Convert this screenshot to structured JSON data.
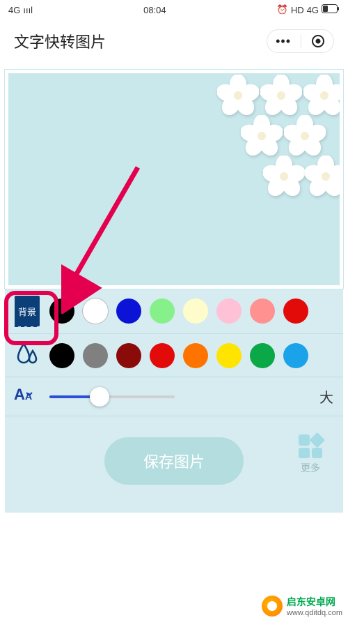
{
  "status": {
    "network": "4G",
    "signal": "ıııl",
    "time": "08:04",
    "alarm": "⏰",
    "hd": "HD",
    "net2": "4G",
    "battery": "▭"
  },
  "nav": {
    "title": "文字快转图片",
    "more_dots": "•••"
  },
  "tools": {
    "bg_label": "背景",
    "bg_colors": [
      "#000000",
      "#ffffff",
      "#0b14d6",
      "#86f08a",
      "#fffccb",
      "#ffc1d5",
      "#ff9191",
      "#e30a0a"
    ],
    "fill_colors": [
      "#000000",
      "#808080",
      "#8b0a0a",
      "#e30a0a",
      "#ff7400",
      "#ffe400",
      "#0aa846",
      "#1aa3e8"
    ],
    "size_label": "大",
    "slider_percent": 40
  },
  "actions": {
    "save": "保存图片",
    "more": "更多"
  },
  "watermark": {
    "cn": "启东安卓网",
    "url": "www.qditdq.com"
  }
}
